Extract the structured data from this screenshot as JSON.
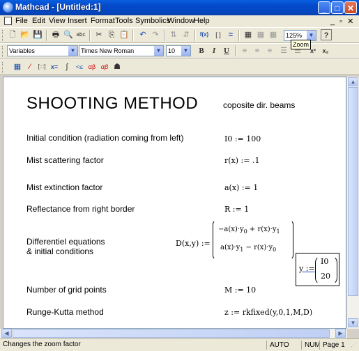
{
  "window": {
    "title": "Mathcad - [Untitled:1]",
    "buttons": {
      "minimize": "_",
      "maximize": "□",
      "close": "✕"
    }
  },
  "menu": {
    "items": [
      "File",
      "Edit",
      "View",
      "Insert",
      "Format",
      "Tools",
      "Symbolics",
      "Window",
      "Help"
    ],
    "mdi_controls": "_ ▫ ✕"
  },
  "toolbar_standard": {
    "zoom_value": "125%",
    "tooltip": "Zoom"
  },
  "toolbar_format": {
    "style_value": "Variables",
    "font_value": "Times New Roman",
    "size_value": "10",
    "bold": "B",
    "italic": "I",
    "underline": "U"
  },
  "icons": {
    "new": "🗋",
    "open": "📂",
    "save": "💾",
    "print": "🖶",
    "preview": "🔍",
    "spell": "abc",
    "cut": "✂",
    "copy": "⎘",
    "paste": "📋",
    "undo": "↶",
    "redo": "↷",
    "align_across": "⇅",
    "align_down": "⇵",
    "insert_function": "f(x)",
    "insert_unit": "[ ]",
    "define": "≡",
    "calculate": "=",
    "component": "▦",
    "help": "?",
    "calculator": "▦",
    "graph": "⁄",
    "matrix": "[:::]",
    "evaluation": "x=",
    "calculus": "∫",
    "boolean": "<≤",
    "programming": "αβ",
    "greek": "αβ",
    "symbolic": "☗"
  },
  "document": {
    "title": "SHOOTING METHOD",
    "subtitle": "coposite dir. beams",
    "rows": [
      {
        "label": "Initial condition (radiation coming from left)",
        "math": "I0 := 100"
      },
      {
        "label": "Mist scattering factor",
        "math": "r(x) := .1"
      },
      {
        "label": "Mist extinction factor",
        "math": "a(x) := 1"
      },
      {
        "label": "Reflectance from right border",
        "math": "R := 1"
      },
      {
        "label": "Differentiel equations\n& initial conditions",
        "math": "D(x,y) :="
      },
      {
        "label": "Number of grid points",
        "math": "M := 10"
      },
      {
        "label": "Runge-Kutta method",
        "math": "z := rkfixed(y,0,1,M,D)"
      }
    ],
    "matrix_row1": "−a(x)·y",
    "matrix_row1_sub": "0",
    "matrix_row1_b": " + r(x)·y",
    "matrix_row1_b_sub": "1",
    "matrix_row2": "a(x)·y",
    "matrix_row2_sub": "1",
    "matrix_row2_b": " − r(x)·y",
    "matrix_row2_b_sub": "0",
    "y_def": "y :=",
    "y_vec": [
      "I0",
      "20"
    ]
  },
  "status": {
    "message": "Changes the zoom factor",
    "mode": "AUTO",
    "num": "NUM",
    "page": "Page 1"
  }
}
